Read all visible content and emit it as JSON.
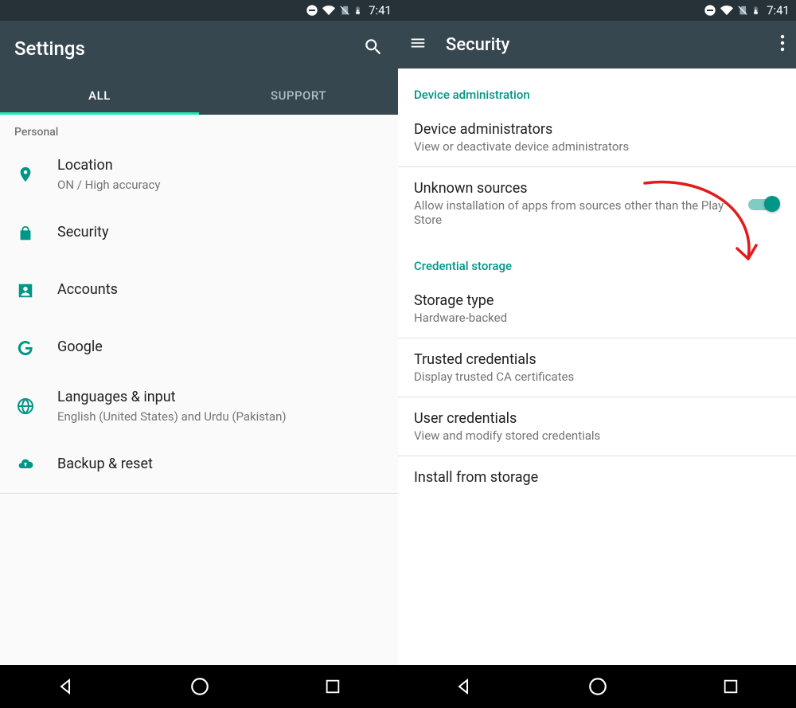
{
  "status": {
    "time": "7:41"
  },
  "left": {
    "title": "Settings",
    "tabs": {
      "all": "ALL",
      "support": "SUPPORT"
    },
    "subheader": "Personal",
    "items": {
      "location": {
        "title": "Location",
        "sub": "ON / High accuracy"
      },
      "security": {
        "title": "Security"
      },
      "accounts": {
        "title": "Accounts"
      },
      "google": {
        "title": "Google"
      },
      "lang": {
        "title": "Languages & input",
        "sub": "English (United States) and Urdu (Pakistan)"
      },
      "backup": {
        "title": "Backup & reset"
      }
    }
  },
  "right": {
    "title": "Security",
    "sections": {
      "device_admin": "Device administration",
      "cred_storage": "Credential storage"
    },
    "items": {
      "device_admins": {
        "title": "Device administrators",
        "sub": "View or deactivate device administrators"
      },
      "unknown_src": {
        "title": "Unknown sources",
        "sub": "Allow installation of apps from sources other than the Play Store"
      },
      "storage_type": {
        "title": "Storage type",
        "sub": "Hardware-backed"
      },
      "trusted": {
        "title": "Trusted credentials",
        "sub": "Display trusted CA certificates"
      },
      "user_creds": {
        "title": "User credentials",
        "sub": "View and modify stored credentials"
      },
      "install": {
        "title": "Install from storage"
      }
    },
    "toggles": {
      "unknown_src": true
    }
  },
  "colors": {
    "accent": "#009688"
  }
}
